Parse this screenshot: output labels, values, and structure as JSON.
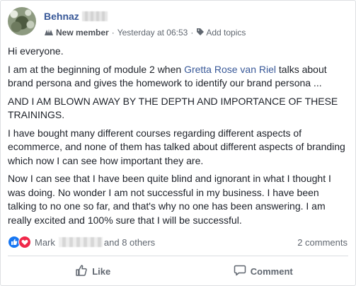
{
  "post": {
    "author_name": "Behnaz",
    "badge": "New member",
    "timestamp": "Yesterday at 06:53",
    "add_topics": "Add topics",
    "paragraphs": {
      "p1": "Hi everyone.",
      "p2_before": "I am at the beginning of module 2 when ",
      "p2_mention": "Gretta Rose van Riel",
      "p2_after": " talks about brand persona and gives the homework to identify our brand persona ...",
      "p3": "AND I AM BLOWN AWAY BY THE DEPTH AND IMPORTANCE OF THESE TRAININGS.",
      "p4": "I have bought many different courses regarding different aspects of ecommerce, and none of them has talked about different aspects of branding which now I can see how important they are.",
      "p5": "Now I can see that I have been quite blind and ignorant in what I thought I was doing. No wonder I am not successful in my business. I have been talking to no one so far, and that's why no one has been answering. I am really excited and 100% sure that I will be successful."
    }
  },
  "reactions": {
    "first_name": "Mark",
    "others": "and 8 others",
    "comments": "2 comments"
  },
  "actions": {
    "like": "Like",
    "comment": "Comment"
  },
  "colors": {
    "link": "#385898",
    "like_reaction": "#1877f2",
    "love_reaction": "#f0284a"
  }
}
